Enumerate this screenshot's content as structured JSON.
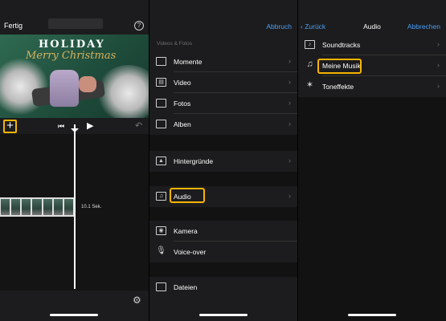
{
  "editor": {
    "done_label": "Fertig",
    "help_label": "?",
    "preview": {
      "line1": "HOLIDAY",
      "line2": "Merry Christmas"
    },
    "controls": {
      "add_label": "+",
      "skip_back_glyph": "⏮",
      "play_glyph": "▶",
      "undo_glyph": "↶"
    },
    "clip_duration": "10.1 Sek.",
    "settings_glyph": "⚙"
  },
  "browser": {
    "cancel_label": "Abbruch",
    "section_label": "Videos & Fotos",
    "items": [
      {
        "label": "Momente",
        "icon": "moments-icon"
      },
      {
        "label": "Video",
        "icon": "film-icon"
      },
      {
        "label": "Fotos",
        "icon": "photos-icon"
      },
      {
        "label": "Alben",
        "icon": "albums-icon"
      },
      {
        "label": "Hintergründe",
        "icon": "backgrounds-icon"
      },
      {
        "label": "Audio",
        "icon": "music-icon"
      },
      {
        "label": "Kamera",
        "icon": "camera-icon"
      },
      {
        "label": "Voice-over",
        "icon": "microphone-icon"
      },
      {
        "label": "Dateien",
        "icon": "folder-icon"
      }
    ],
    "chevron": "›"
  },
  "audio": {
    "back_label": "Zurück",
    "title": "Audio",
    "cancel_label": "Abbrechen",
    "items": [
      {
        "label": "Soundtracks",
        "icon": "soundtracks-icon"
      },
      {
        "label": "Meine Musik",
        "icon": "music-note-icon"
      },
      {
        "label": "Toneffekte",
        "icon": "sound-effects-icon"
      }
    ],
    "chevron": "›"
  },
  "colors": {
    "accent_link": "#4b9ff5",
    "highlight": "#f5b400",
    "background": "#1c1c1e"
  }
}
